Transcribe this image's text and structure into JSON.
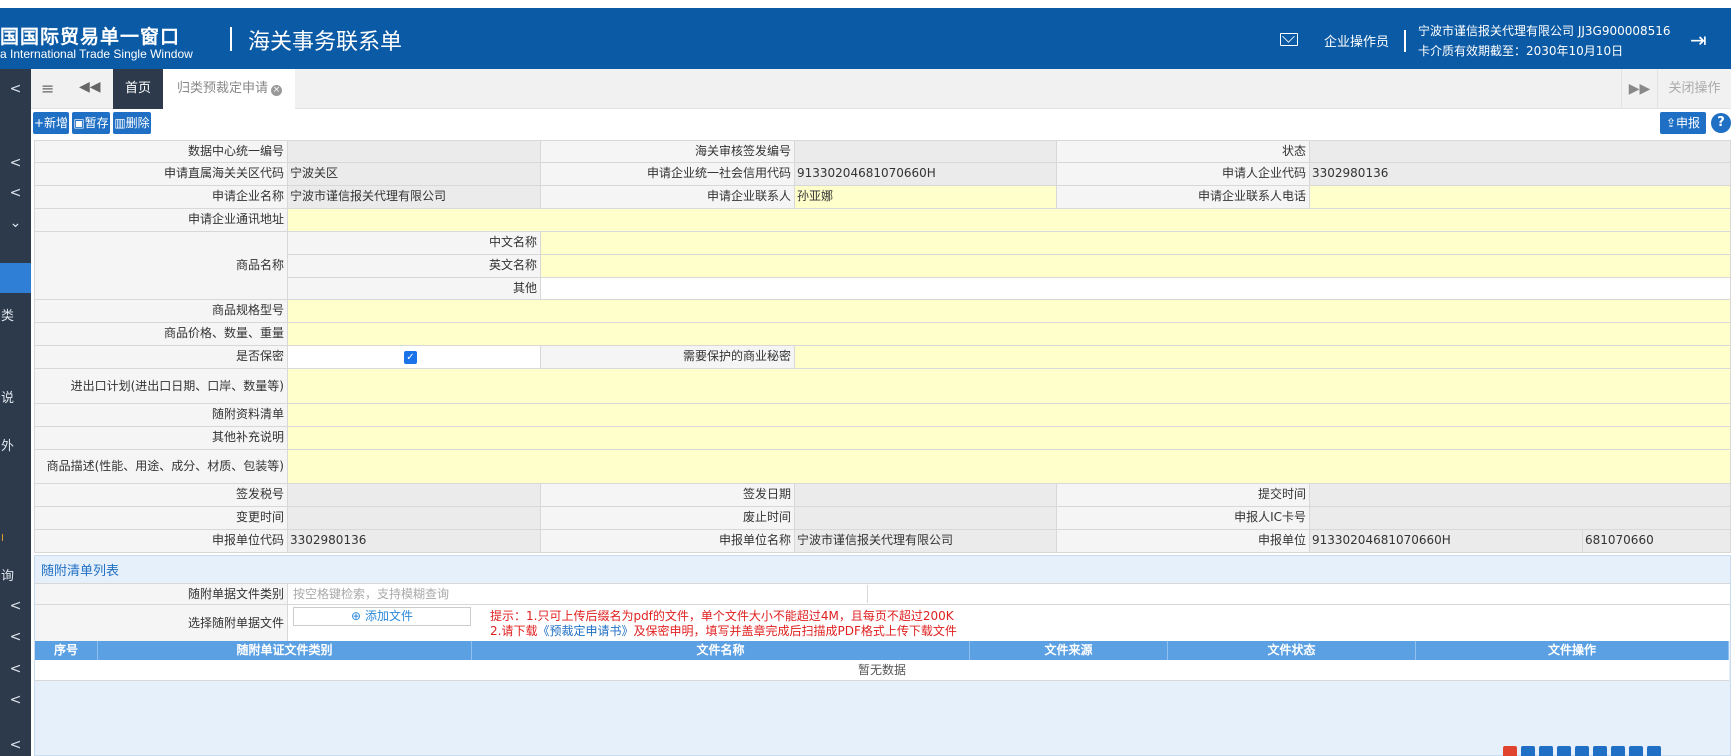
{
  "header": {
    "logo_cn": "国国际贸易单一窗口",
    "logo_en": "a International Trade Single Window",
    "title": "海关事务联系单",
    "operator": "企业操作员",
    "company": "宁波市谨信报关代理有限公司 JJ3G900008516",
    "validity": "卡介质有效期截至：2030年10月10日"
  },
  "sidebar": {
    "items": [
      "<",
      "<",
      "<",
      "⌄",
      "类",
      "说",
      "外",
      "I",
      "询",
      "<",
      "<",
      "<",
      "<",
      "<"
    ]
  },
  "tabs": {
    "home": "首页",
    "apply": "归类预裁定申请",
    "close_ops": "关闭操作"
  },
  "toolbar": {
    "add": "新增",
    "save": "暂存",
    "delete": "删除",
    "submit": "申报",
    "help": "?"
  },
  "form": {
    "data_center_no_label": "数据中心统一编号",
    "data_center_no": "",
    "customs_sign_no_label": "海关审核签发编号",
    "customs_sign_no": "",
    "status_label": "状态",
    "status": "",
    "customs_code_label": "申请直属海关关区代码",
    "customs_code": "宁波关区",
    "credit_code_label": "申请企业统一社会信用代码",
    "credit_code": "91330204681070660H",
    "applicant_code_label": "申请人企业代码",
    "applicant_code": "3302980136",
    "company_name_label": "申请企业名称",
    "company_name": "宁波市谨信报关代理有限公司",
    "contact_label": "申请企业联系人",
    "contact": "孙亚娜",
    "phone_label": "申请企业联系人电话",
    "phone": "",
    "address_label": "申请企业通讯地址",
    "address": "",
    "goods_name_label": "商品名称",
    "cn_name_label": "中文名称",
    "en_name_label": "英文名称",
    "other_label": "其他",
    "spec_label": "商品规格型号",
    "price_label": "商品价格、数量、重量",
    "confidential_label": "是否保密",
    "secret_label": "需要保护的商业秘密",
    "plan_label": "进出口计划(进出口日期、口岸、数量等)",
    "docs_label": "随附资料清单",
    "remarks_label": "其他补充说明",
    "desc_label": "商品描述(性能、用途、成分、材质、包装等)",
    "sign_tax_label": "签发税号",
    "sign_date_label": "签发日期",
    "submit_time_label": "提交时间",
    "change_time_label": "变更时间",
    "abolish_time_label": "废止时间",
    "ic_card_label": "申报人IC卡号",
    "decl_code_label": "申报单位代码",
    "decl_code": "3302980136",
    "decl_name_label": "申报单位名称",
    "decl_name": "宁波市谨信报关代理有限公司",
    "decl_unit_label": "申报单位",
    "decl_unit_credit": "91330204681070660H",
    "decl_unit_extra": "681070660"
  },
  "attachments": {
    "title": "随附清单列表",
    "type_label": "随附单据文件类别",
    "type_placeholder": "按空格键检索，支持模糊查询",
    "file_label": "选择随附单据文件",
    "add_file": "添加文件",
    "tip1": "提示：1.只可上传后缀名为pdf的文件，单个文件大小不能超过4M，且每页不超过200K",
    "tip2_prefix": "2.请下载",
    "tip2_link": "《预裁定申请书》",
    "tip2_suffix": "及保密申明，填写并盖章完成后扫描成PDF格式上传下载文件",
    "columns": [
      "序号",
      "随附单证文件类别",
      "文件名称",
      "文件来源",
      "文件状态",
      "文件操作"
    ],
    "empty": "暂无数据"
  },
  "colors": {
    "header_bg": "#0b5aa5",
    "sidebar_bg": "#2d3a4b",
    "button_bg": "#1f6fc4",
    "required_field": "#ffffcc",
    "table_header": "#5aa0e3",
    "tip_red": "#e02020"
  }
}
